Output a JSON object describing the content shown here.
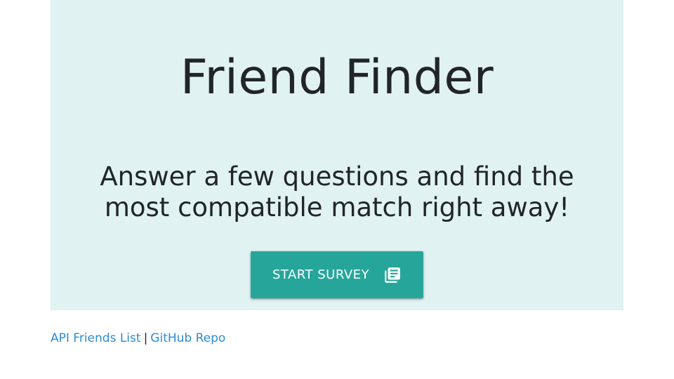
{
  "hero": {
    "title": "Friend Finder",
    "subtitle": "Answer a few questions and find the most compatible match right away!",
    "button": {
      "label": "START SURVEY",
      "icon": "library-books-icon",
      "color": "#26a69a"
    },
    "background_color": "#e0f2f1"
  },
  "footer": {
    "links": [
      {
        "label": "API Friends List"
      },
      {
        "label": "GitHub Repo"
      }
    ],
    "separator": "|",
    "link_color": "#2b8cd6"
  }
}
